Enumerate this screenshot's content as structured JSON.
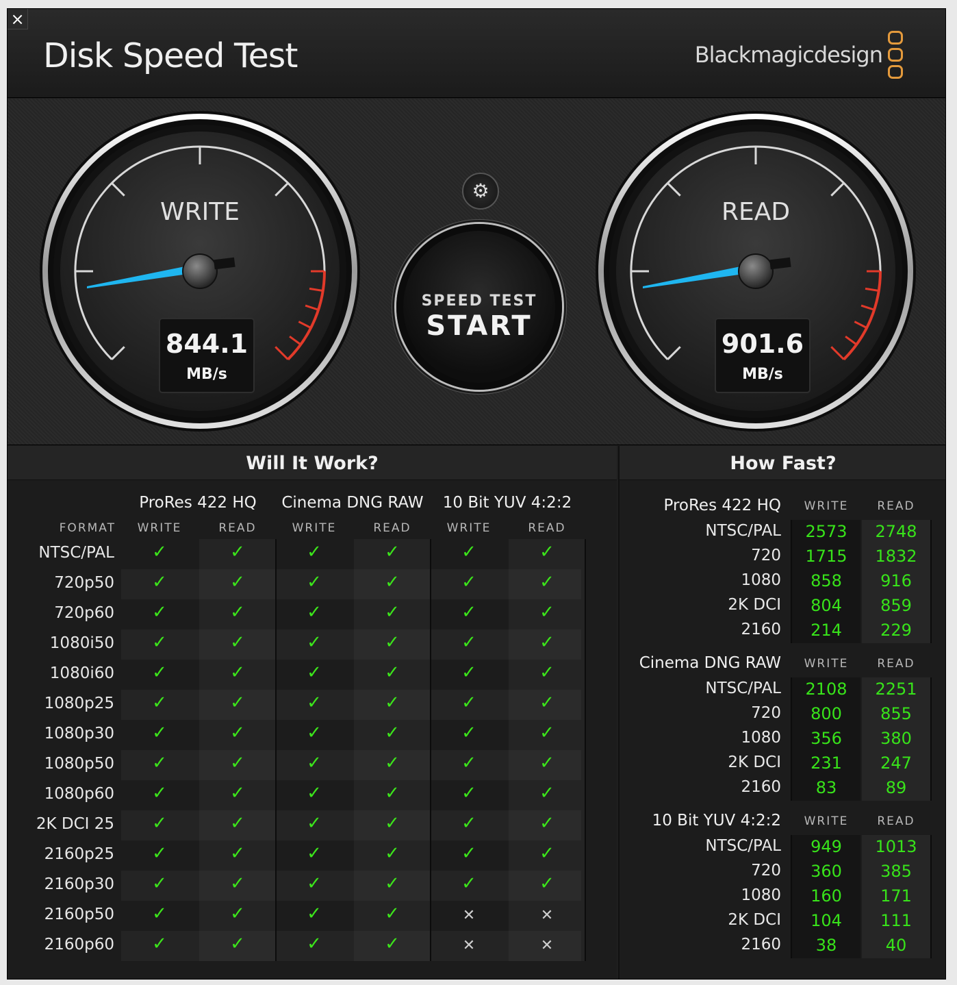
{
  "window": {
    "close_label": "×",
    "title": "Disk Speed Test",
    "brand": "Blackmagicdesign",
    "brand_color": "#e49a3c"
  },
  "gauges": {
    "write": {
      "label": "WRITE",
      "value": "844.1",
      "unit": "MB/s"
    },
    "read": {
      "label": "READ",
      "value": "901.6",
      "unit": "MB/s"
    },
    "needle_color": "#1fb6f0",
    "redline_color": "#e23a2a"
  },
  "controls": {
    "settings_icon": "gear-icon",
    "settings_glyph": "⚙",
    "start_small": "SPEED TEST",
    "start_big": "START"
  },
  "will_it_work": {
    "title": "Will It Work?",
    "format_label": "FORMAT",
    "write_label": "WRITE",
    "read_label": "READ",
    "codecs": [
      "ProRes 422 HQ",
      "Cinema DNG RAW",
      "10 Bit YUV 4:2:2"
    ],
    "check_glyph": "✓",
    "cross_glyph": "✕",
    "rows": [
      {
        "format": "NTSC/PAL",
        "results": [
          1,
          1,
          1,
          1,
          1,
          1
        ]
      },
      {
        "format": "720p50",
        "results": [
          1,
          1,
          1,
          1,
          1,
          1
        ]
      },
      {
        "format": "720p60",
        "results": [
          1,
          1,
          1,
          1,
          1,
          1
        ]
      },
      {
        "format": "1080i50",
        "results": [
          1,
          1,
          1,
          1,
          1,
          1
        ]
      },
      {
        "format": "1080i60",
        "results": [
          1,
          1,
          1,
          1,
          1,
          1
        ]
      },
      {
        "format": "1080p25",
        "results": [
          1,
          1,
          1,
          1,
          1,
          1
        ]
      },
      {
        "format": "1080p30",
        "results": [
          1,
          1,
          1,
          1,
          1,
          1
        ]
      },
      {
        "format": "1080p50",
        "results": [
          1,
          1,
          1,
          1,
          1,
          1
        ]
      },
      {
        "format": "1080p60",
        "results": [
          1,
          1,
          1,
          1,
          1,
          1
        ]
      },
      {
        "format": "2K DCI 25",
        "results": [
          1,
          1,
          1,
          1,
          1,
          1
        ]
      },
      {
        "format": "2160p25",
        "results": [
          1,
          1,
          1,
          1,
          1,
          1
        ]
      },
      {
        "format": "2160p30",
        "results": [
          1,
          1,
          1,
          1,
          1,
          1
        ]
      },
      {
        "format": "2160p50",
        "results": [
          1,
          1,
          1,
          1,
          0,
          0
        ]
      },
      {
        "format": "2160p60",
        "results": [
          1,
          1,
          1,
          1,
          0,
          0
        ]
      }
    ]
  },
  "how_fast": {
    "title": "How Fast?",
    "write_label": "WRITE",
    "read_label": "READ",
    "groups": [
      {
        "codec": "ProRes 422 HQ",
        "rows": [
          {
            "format": "NTSC/PAL",
            "write": "2573",
            "read": "2748"
          },
          {
            "format": "720",
            "write": "1715",
            "read": "1832"
          },
          {
            "format": "1080",
            "write": "858",
            "read": "916"
          },
          {
            "format": "2K DCI",
            "write": "804",
            "read": "859"
          },
          {
            "format": "2160",
            "write": "214",
            "read": "229"
          }
        ]
      },
      {
        "codec": "Cinema DNG RAW",
        "rows": [
          {
            "format": "NTSC/PAL",
            "write": "2108",
            "read": "2251"
          },
          {
            "format": "720",
            "write": "800",
            "read": "855"
          },
          {
            "format": "1080",
            "write": "356",
            "read": "380"
          },
          {
            "format": "2K DCI",
            "write": "231",
            "read": "247"
          },
          {
            "format": "2160",
            "write": "83",
            "read": "89"
          }
        ]
      },
      {
        "codec": "10 Bit YUV 4:2:2",
        "rows": [
          {
            "format": "NTSC/PAL",
            "write": "949",
            "read": "1013"
          },
          {
            "format": "720",
            "write": "360",
            "read": "385"
          },
          {
            "format": "1080",
            "write": "160",
            "read": "171"
          },
          {
            "format": "2K DCI",
            "write": "104",
            "read": "111"
          },
          {
            "format": "2160",
            "write": "38",
            "read": "40"
          }
        ]
      }
    ]
  }
}
